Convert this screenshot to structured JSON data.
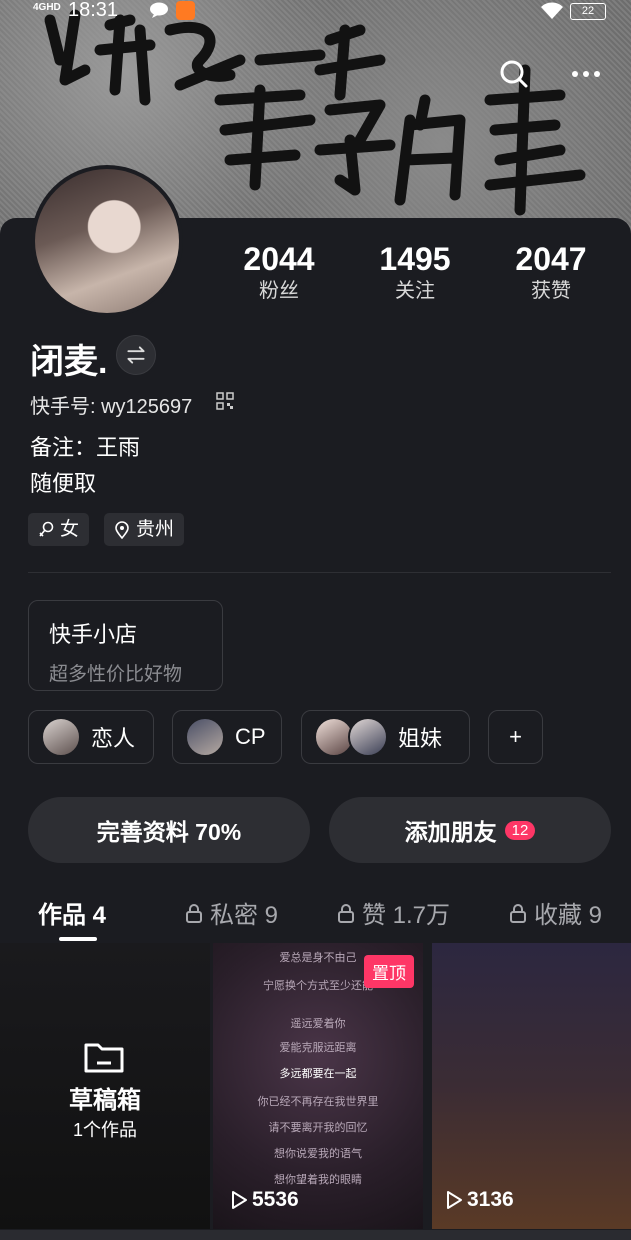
{
  "status_bar": {
    "network": "4GHD",
    "time": "18:31",
    "battery": "22"
  },
  "cover": {
    "text": "你是一辈子的事"
  },
  "profile": {
    "name": "闭麦.",
    "user_id": "快手号: wy125697",
    "remark": "备注：王雨",
    "bio": "随便取",
    "gender_tag": "女",
    "location_tag": "贵州"
  },
  "stats": [
    {
      "value": "2044",
      "label": "粉丝"
    },
    {
      "value": "1495",
      "label": "关注"
    },
    {
      "value": "2047",
      "label": "获赞"
    }
  ],
  "shop": {
    "title": "快手小店",
    "subtitle": "超多性价比好物"
  },
  "relations": [
    {
      "label": "恋人"
    },
    {
      "label": "CP"
    },
    {
      "label": "姐妹"
    },
    {
      "label": "+"
    }
  ],
  "actions": {
    "complete_profile": "完善资料 70%",
    "add_friends": "添加朋友",
    "add_friends_badge": "12"
  },
  "tabs": [
    {
      "label": "作品 4"
    },
    {
      "label": "私密 9"
    },
    {
      "label": "赞 1.7万"
    },
    {
      "label": "收藏 9"
    }
  ],
  "grid": {
    "drafts_title": "草稿箱",
    "drafts_count": "1个作品",
    "pinned_label": "置顶",
    "plays": [
      "5536",
      "3136"
    ],
    "lyrics": [
      "爱总是身不由己",
      "宁愿换个方式至少还能",
      "遥远爱着你",
      "爱能克服远距离",
      "多远都要在一起",
      "你已经不再存在我世界里",
      "请不要离开我的回忆",
      "想你说爱我的语气",
      "想你望着我的眼睛"
    ]
  }
}
